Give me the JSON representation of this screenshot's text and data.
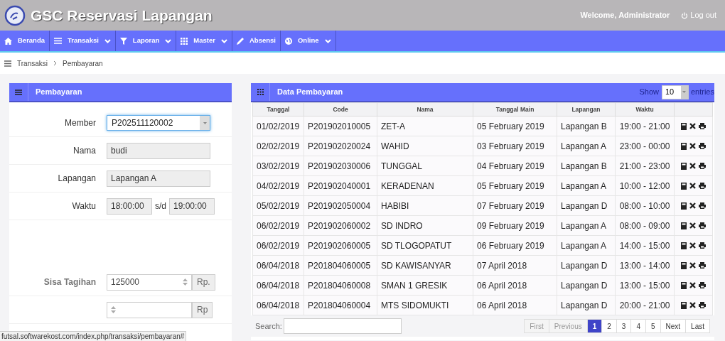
{
  "header": {
    "title": "GSC Reservasi Lapangan",
    "welcome": "Welcome, Administrator",
    "logout": "Log out"
  },
  "nav": [
    {
      "label": "Beranda",
      "dropdown": false
    },
    {
      "label": "Transaksi",
      "dropdown": true
    },
    {
      "label": "Laporan",
      "dropdown": true
    },
    {
      "label": "Master",
      "dropdown": true
    },
    {
      "label": "Absensi",
      "dropdown": false
    },
    {
      "label": "Online",
      "dropdown": true
    }
  ],
  "breadcrumb": [
    "Transaksi",
    "Pembayaran"
  ],
  "form": {
    "title": "Pembayaran",
    "rows": [
      {
        "kind": "select",
        "label": "Member",
        "value": "P202511120002"
      },
      {
        "kind": "text",
        "label": "Nama",
        "value": "budi"
      },
      {
        "kind": "text",
        "label": "Lapangan",
        "value": "Lapangan A"
      },
      {
        "kind": "range",
        "label": "Waktu",
        "value": "18:00:00",
        "separator": "s/d",
        "value_2": "19:00:00"
      },
      {
        "kind": "money",
        "label": "Sisa Tagihan",
        "value": "125000",
        "suffix": "Rp."
      },
      {
        "kind": "money",
        "label": "",
        "value": "",
        "suffix": "Rp"
      }
    ]
  },
  "table": {
    "title": "Data Pembayaran",
    "show_label": "Show",
    "page_size": "10",
    "entries_label": "entries",
    "columns": [
      "Tanggal",
      "Code",
      "Nama",
      "Tanggal Main",
      "Lapangan",
      "Waktu"
    ],
    "rows": [
      [
        "01/02/2019",
        "P201902010005",
        "ZET-A",
        "05 February 2019",
        "Lapangan B",
        "19:00 - 21:00"
      ],
      [
        "02/02/2019",
        "P201902020024",
        "WAHID",
        "03 February 2019",
        "Lapangan A",
        "23:00 - 00:00"
      ],
      [
        "03/02/2019",
        "P201902030006",
        "TUNGGAL",
        "04 February 2019",
        "Lapangan B",
        "21:00 - 23:00"
      ],
      [
        "04/02/2019",
        "P201902040001",
        "KERADENAN",
        "05 February 2019",
        "Lapangan A",
        "10:00 - 12:00"
      ],
      [
        "05/02/2019",
        "P201902050004",
        "HABIBI",
        "07 February 2019",
        "Lapangan D",
        "08:00 - 10:00"
      ],
      [
        "06/02/2019",
        "P201902060002",
        "SD INDRO",
        "09 February 2019",
        "Lapangan A",
        "08:00 - 09:00"
      ],
      [
        "06/02/2019",
        "P201902060005",
        "SD TLOGOPATUT",
        "06 February 2019",
        "Lapangan A",
        "14:00 - 15:00"
      ],
      [
        "06/04/2018",
        "P201804060005",
        "SD KAWISANYAR",
        "07 April 2018",
        "Lapangan D",
        "13:00 - 14:00"
      ],
      [
        "06/04/2018",
        "P201804060008",
        "SMAN 1 GRESIK",
        "06 April 2018",
        "Lapangan D",
        "13:00 - 15:00"
      ],
      [
        "06/04/2018",
        "P201804060004",
        "MTS SIDOMUKTI",
        "06 April 2018",
        "Lapangan D",
        "20:00 - 21:00"
      ]
    ],
    "search_label": "Search:",
    "pagination": [
      {
        "label": "First",
        "selected": false,
        "disabled": true
      },
      {
        "label": "Previous",
        "selected": false,
        "disabled": true
      },
      {
        "label": "1",
        "selected": true,
        "disabled": false
      },
      {
        "label": "2",
        "selected": false,
        "disabled": false
      },
      {
        "label": "3",
        "selected": false,
        "disabled": false
      },
      {
        "label": "4",
        "selected": false,
        "disabled": false
      },
      {
        "label": "5",
        "selected": false,
        "disabled": false
      },
      {
        "label": "Next",
        "selected": false,
        "disabled": false
      },
      {
        "label": "Last",
        "selected": false,
        "disabled": false
      }
    ]
  },
  "status_bar": {
    "url": "futsal.softwarekost.com/index.php/transaksi/pembayaran#"
  }
}
